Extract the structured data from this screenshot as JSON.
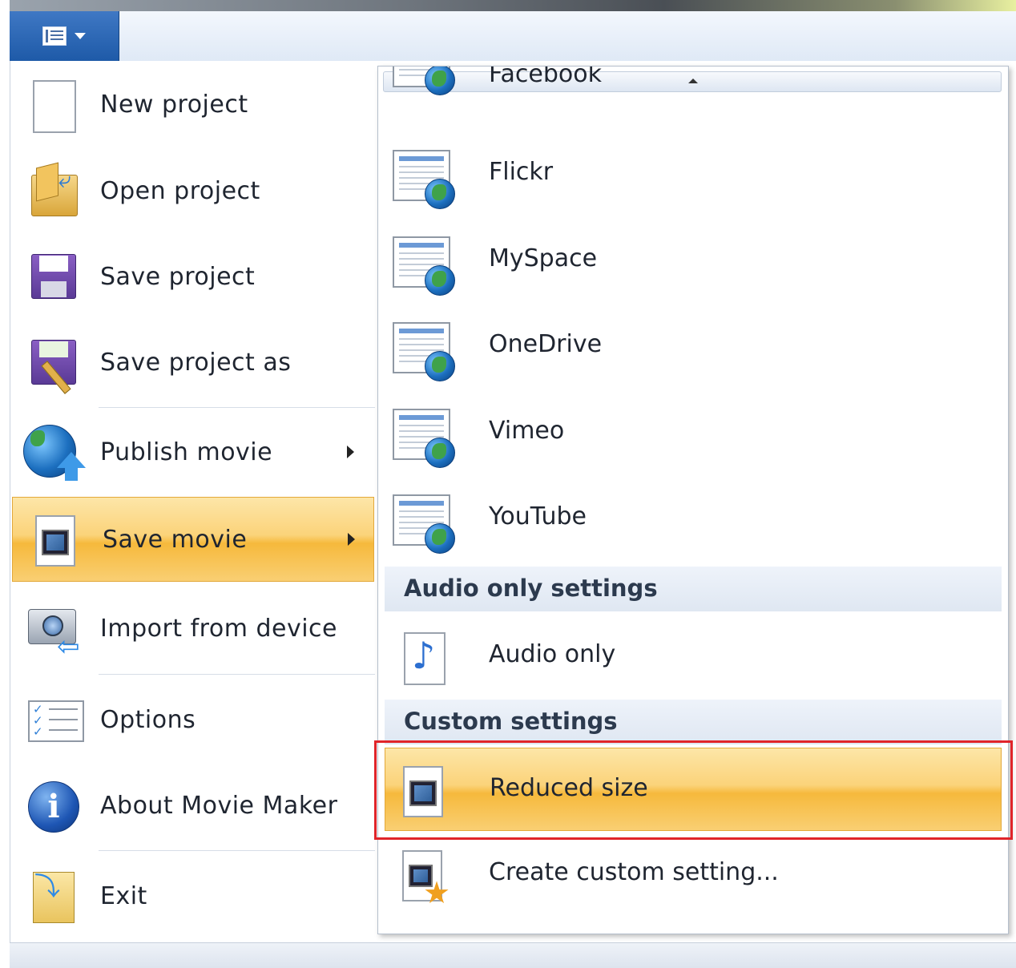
{
  "app_menu": {
    "button_icon": "app-menu-icon",
    "left_items": [
      {
        "label": "New project",
        "icon": "new-project-icon",
        "has_submenu": false
      },
      {
        "label": "Open project",
        "icon": "open-folder-icon",
        "has_submenu": false
      },
      {
        "label": "Save project",
        "icon": "floppy-disk-icon",
        "has_submenu": false
      },
      {
        "label": "Save project as",
        "icon": "floppy-edit-icon",
        "has_submenu": false
      },
      {
        "label": "Publish movie",
        "icon": "publish-globe-icon",
        "has_submenu": true
      },
      {
        "label": "Save movie",
        "icon": "movie-file-icon",
        "has_submenu": true,
        "selected": true
      },
      {
        "label": "Import from device",
        "icon": "camera-import-icon",
        "has_submenu": false
      },
      {
        "label": "Options",
        "icon": "checklist-icon",
        "has_submenu": false
      },
      {
        "label": "About Movie Maker",
        "icon": "info-icon",
        "has_submenu": false
      },
      {
        "label": "Exit",
        "icon": "exit-icon",
        "has_submenu": false
      }
    ]
  },
  "submenu": {
    "items": [
      {
        "label": "Facebook",
        "icon": "web-document-icon"
      },
      {
        "label": "Flickr",
        "icon": "web-document-icon"
      },
      {
        "label": "MySpace",
        "icon": "web-document-icon"
      },
      {
        "label": "OneDrive",
        "icon": "web-document-icon"
      },
      {
        "label": "Vimeo",
        "icon": "web-document-icon"
      },
      {
        "label": "YouTube",
        "icon": "web-document-icon"
      }
    ],
    "audio_header": "Audio only settings",
    "audio_item": {
      "label": "Audio only",
      "icon": "music-note-icon"
    },
    "custom_header": "Custom settings",
    "custom_items": [
      {
        "label": "Reduced size",
        "icon": "movie-file-icon",
        "selected": true
      },
      {
        "label": "Create custom setting...",
        "icon": "movie-star-icon"
      }
    ]
  },
  "colors": {
    "highlight": "#f6b93c",
    "annotation_box": "#e0242a"
  }
}
